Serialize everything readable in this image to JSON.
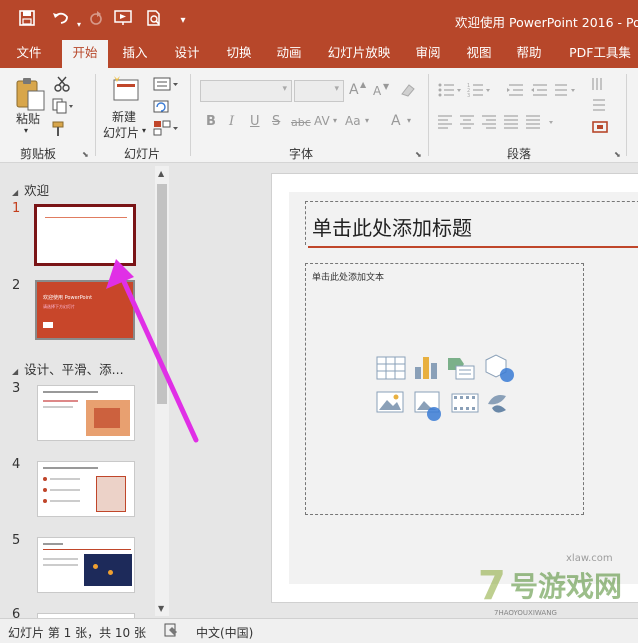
{
  "window": {
    "title": "欢迎使用 PowerPoint 2016 - Po"
  },
  "quick_access": {
    "save_icon": "save-icon",
    "undo_icon": "undo-icon",
    "redo_icon": "redo-icon",
    "present_icon": "present-from-beginning-icon",
    "preview_icon": "print-preview-icon",
    "customize_icon": "chevron-down-icon"
  },
  "tabs": [
    {
      "label": "文件"
    },
    {
      "label": "开始"
    },
    {
      "label": "插入"
    },
    {
      "label": "设计"
    },
    {
      "label": "切换"
    },
    {
      "label": "动画"
    },
    {
      "label": "幻灯片放映"
    },
    {
      "label": "审阅"
    },
    {
      "label": "视图"
    },
    {
      "label": "帮助"
    },
    {
      "label": "PDF工具集"
    }
  ],
  "ribbon": {
    "clipboard": {
      "label": "剪贴板",
      "paste": "粘贴"
    },
    "slides": {
      "label": "幻灯片",
      "new_slide": "新建",
      "new_slide_2": "幻灯片"
    },
    "font": {
      "label": "字体",
      "bold": "B",
      "italic": "I",
      "underline": "U",
      "strike": "S",
      "abc": "abc",
      "spacing": "AV",
      "case": "Aa",
      "color": "A",
      "grow": "A",
      "shrink": "A"
    },
    "paragraph": {
      "label": "段落"
    }
  },
  "slide_panel": {
    "sections": [
      {
        "label": "欢迎"
      },
      {
        "label": "设计、平滑、添..."
      }
    ],
    "slides": [
      {
        "num": "1"
      },
      {
        "num": "2"
      },
      {
        "num": "3"
      },
      {
        "num": "4"
      },
      {
        "num": "5"
      },
      {
        "num": "6"
      }
    ],
    "thumb2_title": "欢迎使用 PowerPoint",
    "thumb2_sub": "请选择下方幻灯片"
  },
  "editor": {
    "title_placeholder": "单击此处添加标题",
    "body_placeholder": "单击此处添加文本"
  },
  "status": {
    "slide_info": "幻灯片 第 1 张，共 10 张",
    "language": "中文(中国)"
  },
  "watermark": {
    "num": "7",
    "text": "号游戏网",
    "domain": "7HAOYOUXIWANG",
    "url": "xlaw.com"
  },
  "colors": {
    "accent": "#b7472a",
    "selected_slide": "#7a1416",
    "arrow": "#e02fe6",
    "title_rule": "#c0462a"
  }
}
